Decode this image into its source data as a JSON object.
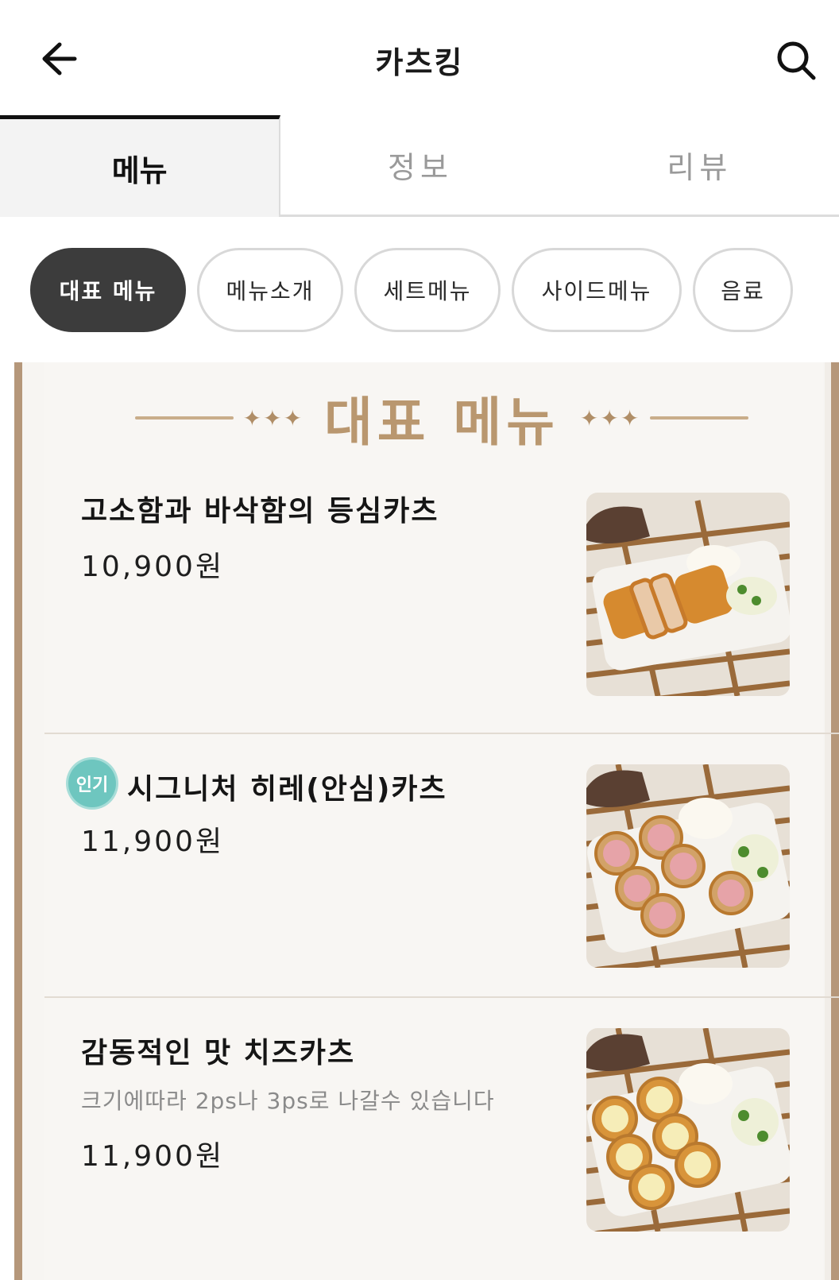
{
  "header": {
    "title": "카츠킹",
    "back_icon": "arrow-left-icon",
    "search_icon": "search-icon"
  },
  "tabs": [
    {
      "label": "메뉴",
      "active": true
    },
    {
      "label": "정보",
      "active": false
    },
    {
      "label": "리뷰",
      "active": false
    }
  ],
  "categories": [
    {
      "label": "대표 메뉴",
      "active": true
    },
    {
      "label": "메뉴소개",
      "active": false
    },
    {
      "label": "세트메뉴",
      "active": false
    },
    {
      "label": "사이드메뉴",
      "active": false
    },
    {
      "label": "음료",
      "active": false
    }
  ],
  "section": {
    "title": "대표 메뉴",
    "sparkles_left": "✦✦✦",
    "sparkles_right": "✦✦✦"
  },
  "items": [
    {
      "name": "고소함과 바삭함의 등심카츠",
      "price": "10,900원",
      "description": "",
      "badge": "",
      "image": "loin-katsu-photo"
    },
    {
      "name": "시그니처 히레(안심)카츠",
      "price": "11,900원",
      "description": "",
      "badge": "인기",
      "image": "tenderloin-katsu-photo"
    },
    {
      "name": "감동적인 맛 치즈카츠",
      "price": "11,900원",
      "description": "크기에따라 2ps나 3ps로 나갈수 있습니다",
      "badge": "",
      "image": "cheese-katsu-photo"
    }
  ],
  "colors": {
    "accent_gold": "#b9976f",
    "board_frame": "#b5977a",
    "chip_active": "#3c3c3c",
    "badge": "#6ec6bf"
  }
}
